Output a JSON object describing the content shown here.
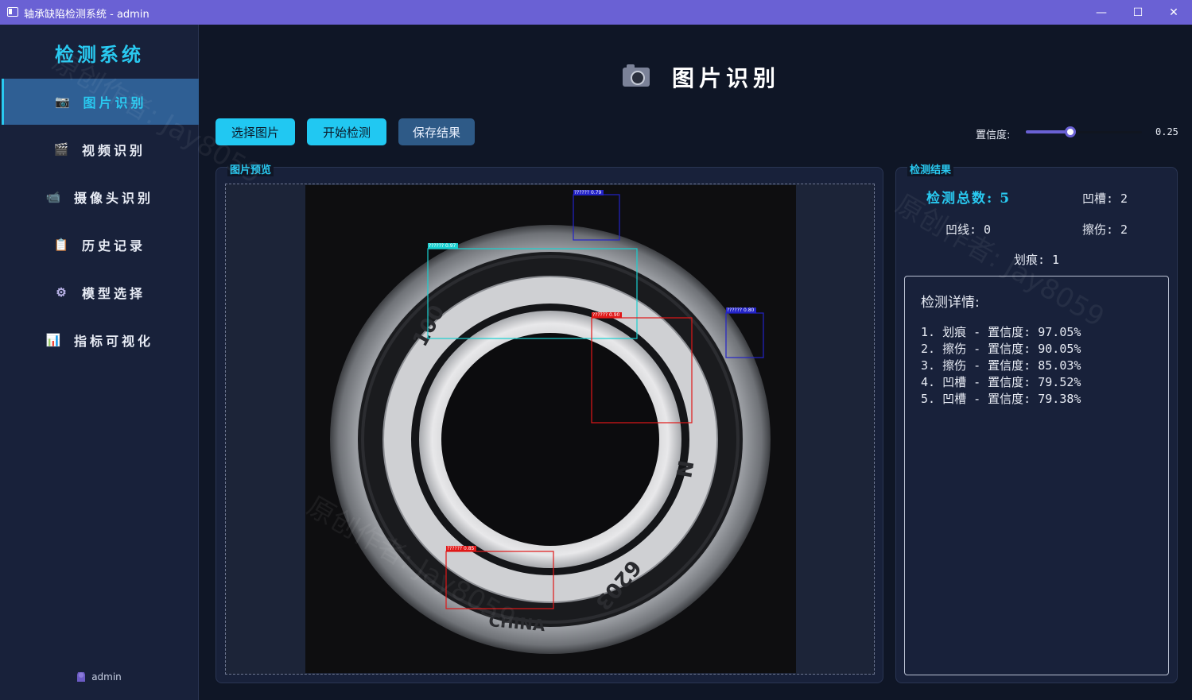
{
  "window": {
    "title": "轴承缺陷检测系统 - admin",
    "minimize": "—",
    "maximize": "☐",
    "close": "✕"
  },
  "sidebar": {
    "brand": "检测系统",
    "items": [
      {
        "label": "图片识别",
        "icon": "📷",
        "active": true
      },
      {
        "label": "视频识别",
        "icon": "🎬",
        "active": false
      },
      {
        "label": "摄像头识别",
        "icon": "📹",
        "active": false
      },
      {
        "label": "历史记录",
        "icon": "📋",
        "active": false
      },
      {
        "label": "模型选择",
        "icon": "⚙",
        "active": false
      },
      {
        "label": "指标可视化",
        "icon": "📊",
        "active": false
      }
    ],
    "user": "admin"
  },
  "header": {
    "title": "图片识别",
    "icon": "camera-icon"
  },
  "toolbar": {
    "select_label": "选择图片",
    "detect_label": "开始检测",
    "save_label": "保存结果",
    "confidence_label": "置信度:",
    "confidence_value": "0.25",
    "confidence": 0.25
  },
  "preview": {
    "title": "图片预览",
    "boxes": [
      {
        "label": "?????? 0.79",
        "color": "#2323c8"
      },
      {
        "label": "?????? 0.97",
        "color": "#19d0d0"
      },
      {
        "label": "?????? 0.90",
        "color": "#e01818"
      },
      {
        "label": "?????? 0.80",
        "color": "#2323c8"
      },
      {
        "label": "?????? 0.85",
        "color": "#e01818"
      }
    ]
  },
  "results": {
    "title": "检测结果",
    "total": "检测总数: 5",
    "groove": "凹槽: 2",
    "dent_line": "凹线: 0",
    "abrasion": "擦伤: 2",
    "scratch": "划痕: 1",
    "detail_title": "检测详情:",
    "details": [
      "1. 划痕 - 置信度: 97.05%",
      "2. 擦伤 - 置信度: 90.05%",
      "3. 擦伤 - 置信度: 85.03%",
      "4. 凹槽 - 置信度: 79.52%",
      "5. 凹槽 - 置信度: 79.38%"
    ]
  },
  "watermark": "原创作者: Jay8059",
  "colors": {
    "accent": "#29c9f0",
    "titlebar": "#6a61d4",
    "active_nav": "#2f5f94",
    "background": "#0f1626",
    "panel": "#18213a"
  }
}
